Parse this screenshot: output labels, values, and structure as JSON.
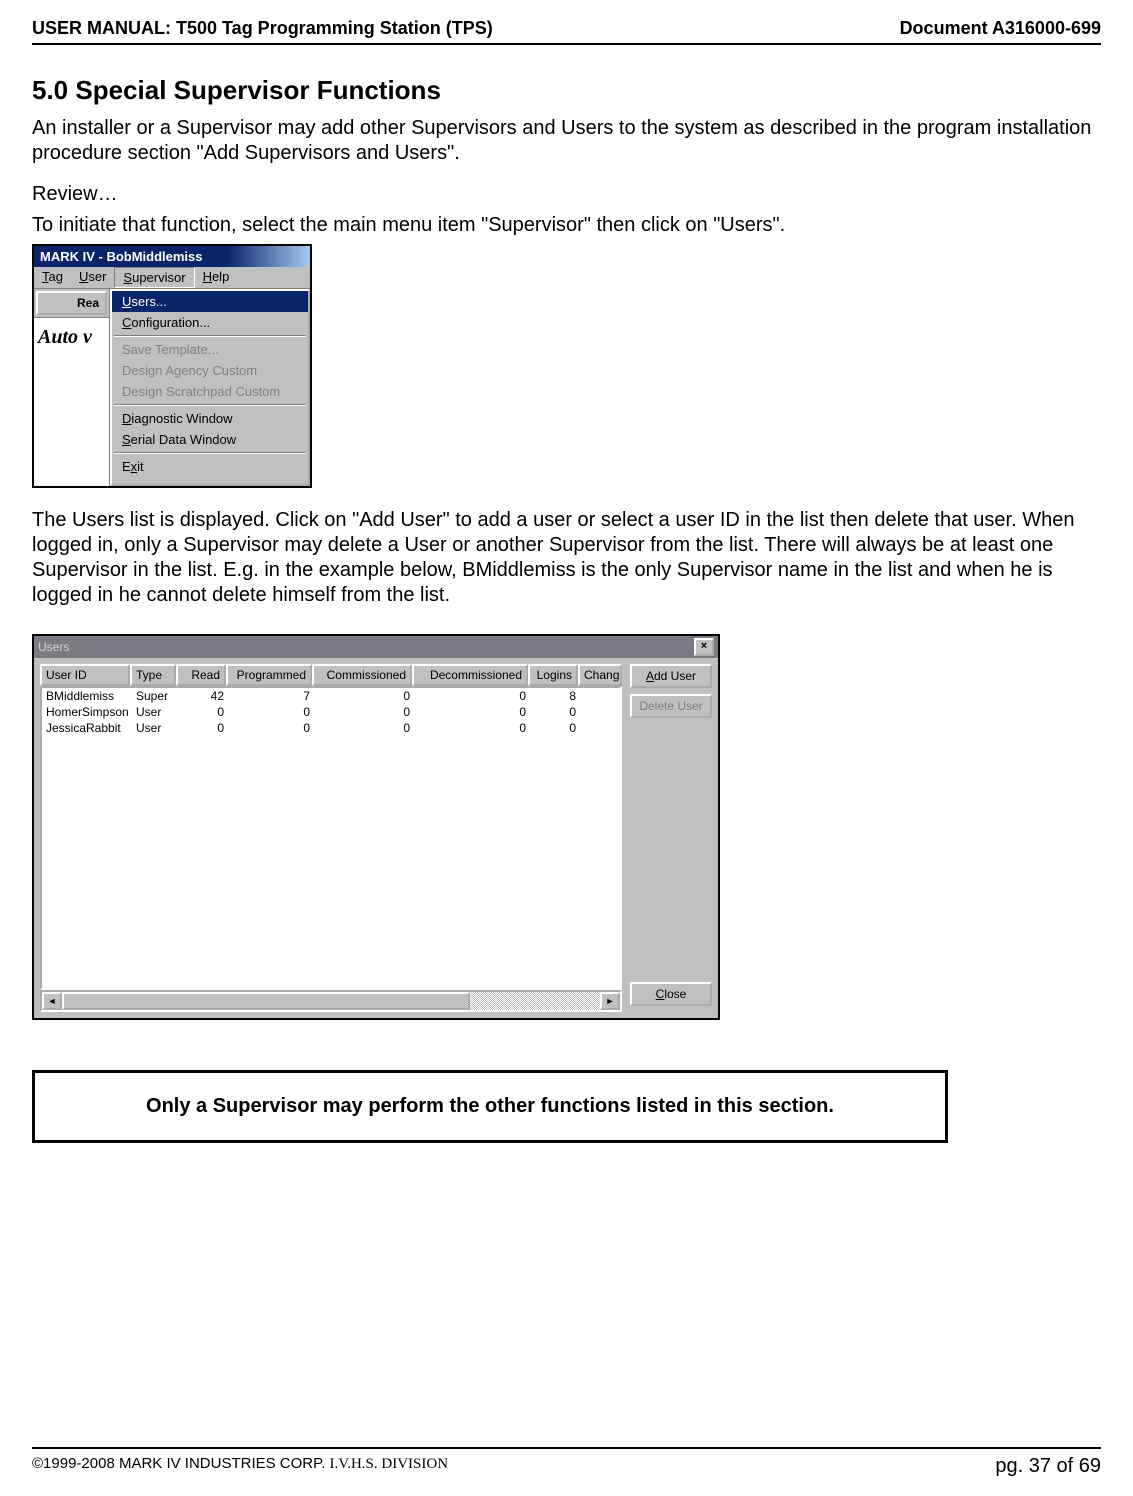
{
  "header": {
    "left": "USER MANUAL: T500 Tag Programming Station (TPS)",
    "right": "Document A316000-699"
  },
  "section": {
    "title": "5.0 Special Supervisor Functions",
    "para1": "An installer or a Supervisor may add other Supervisors and Users to the system as described in the program installation procedure section \"Add Supervisors and Users\".",
    "review": "Review…",
    "para2": "To initiate that function, select the main menu item \"Supervisor\" then click on \"Users\".",
    "para3": "The Users list is displayed. Click on \"Add User\" to add a user or select a user ID in the list then delete that user. When logged in, only a Supervisor may delete a User or another Supervisor from the list. There will always be at least one Supervisor in the list. E.g. in the example below, BMiddlemiss is the only Supervisor name in the list and when he is logged in he cannot delete himself from the list."
  },
  "menu_shot": {
    "title": "MARK IV - BobMiddlemiss",
    "menubar": {
      "tag": "Tag",
      "user": "User",
      "supervisor": "Supervisor",
      "help": "Help"
    },
    "left": {
      "read": "Rea",
      "auto": "Auto v"
    },
    "dropdown": {
      "users": "Users...",
      "configuration": "Configuration...",
      "save_template": "Save Template...",
      "design_agency": "Design Agency Custom",
      "design_scratchpad": "Design Scratchpad Custom",
      "diagnostic": "Diagnostic Window",
      "serial": "Serial Data Window",
      "exit": "Exit"
    }
  },
  "users_shot": {
    "title": "Users",
    "close": "×",
    "columns": {
      "userid": "User ID",
      "type": "Type",
      "read": "Read",
      "programmed": "Programmed",
      "commissioned": "Commissioned",
      "decommissioned": "Decommissioned",
      "logins": "Logins",
      "change": "Change Pass"
    },
    "rows": [
      {
        "userid": "BMiddlemiss",
        "type": "Super",
        "read": "42",
        "programmed": "7",
        "commissioned": "0",
        "decommissioned": "0",
        "logins": "8"
      },
      {
        "userid": "HomerSimpson",
        "type": "User",
        "read": "0",
        "programmed": "0",
        "commissioned": "0",
        "decommissioned": "0",
        "logins": "0"
      },
      {
        "userid": "JessicaRabbit",
        "type": "User",
        "read": "0",
        "programmed": "0",
        "commissioned": "0",
        "decommissioned": "0",
        "logins": "0"
      }
    ],
    "buttons": {
      "add": "Add User",
      "delete": "Delete User",
      "close": "Close"
    },
    "scroll": {
      "left": "◄",
      "right": "►"
    }
  },
  "note": "Only a Supervisor may perform the other functions listed in this section.",
  "footer": {
    "copyright": "©1999-2008 MARK IV INDUSTRIES CORP. ",
    "ivhs": "I.V.H.S. DIVISION",
    "page": "pg. 37 of 69"
  }
}
